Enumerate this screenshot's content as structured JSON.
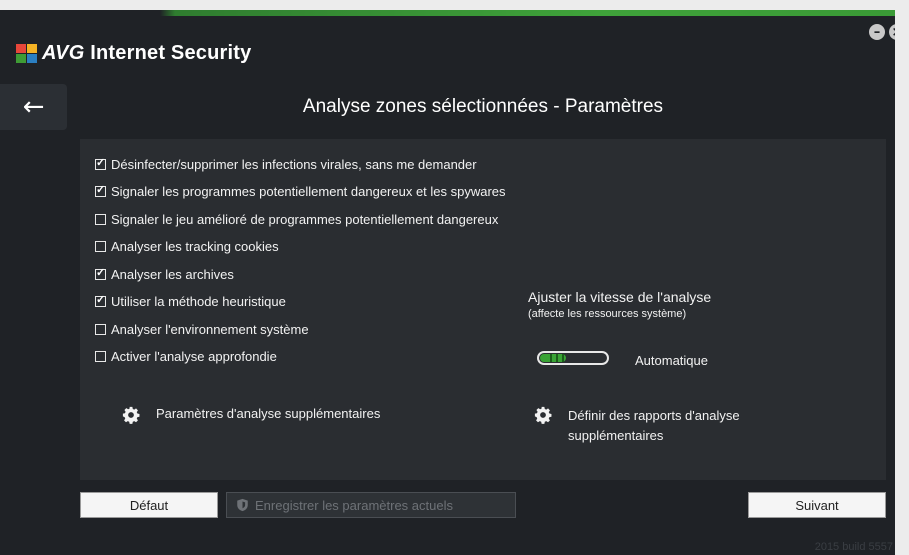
{
  "app": {
    "brand_avg": "AVG",
    "brand_rest": "Internet Security"
  },
  "window_controls": {
    "minimize": "–",
    "close": "×"
  },
  "header": {
    "back": "←",
    "title": "Analyse zones sélectionnées - Paramètres"
  },
  "options": [
    {
      "label": "Désinfecter/supprimer les infections virales, sans me demander",
      "checked": true
    },
    {
      "label": "Signaler les programmes potentiellement dangereux et les spywares",
      "checked": true
    },
    {
      "label": "Signaler le jeu amélioré de programmes potentiellement dangereux",
      "checked": false
    },
    {
      "label": "Analyser les tracking cookies",
      "checked": false
    },
    {
      "label": "Analyser les archives",
      "checked": true
    },
    {
      "label": "Utiliser la méthode heuristique",
      "checked": true
    },
    {
      "label": "Analyser l'environnement système",
      "checked": false
    },
    {
      "label": "Activer l'analyse approfondie",
      "checked": false
    }
  ],
  "speed": {
    "title": "Ajuster la vitesse de l'analyse",
    "subtitle": "(affecte les ressources système)",
    "value_label": "Automatique",
    "level": 0.4
  },
  "links": {
    "additional_params": "Paramètres d'analyse supplémentaires",
    "additional_reports": "Définir des rapports d'analyse supplémentaires"
  },
  "footer": {
    "default_label": "Défaut",
    "save_label": "Enregistrer les paramètres actuels",
    "next_label": "Suivant",
    "build": "2015 build 5557"
  },
  "colors": {
    "accent_green": "#3fa33a",
    "background": "#1f2226",
    "panel": "#2a2d31"
  },
  "icons": {
    "back": "arrow-left-icon",
    "gear": "gear-icon",
    "shield": "shield-icon"
  }
}
